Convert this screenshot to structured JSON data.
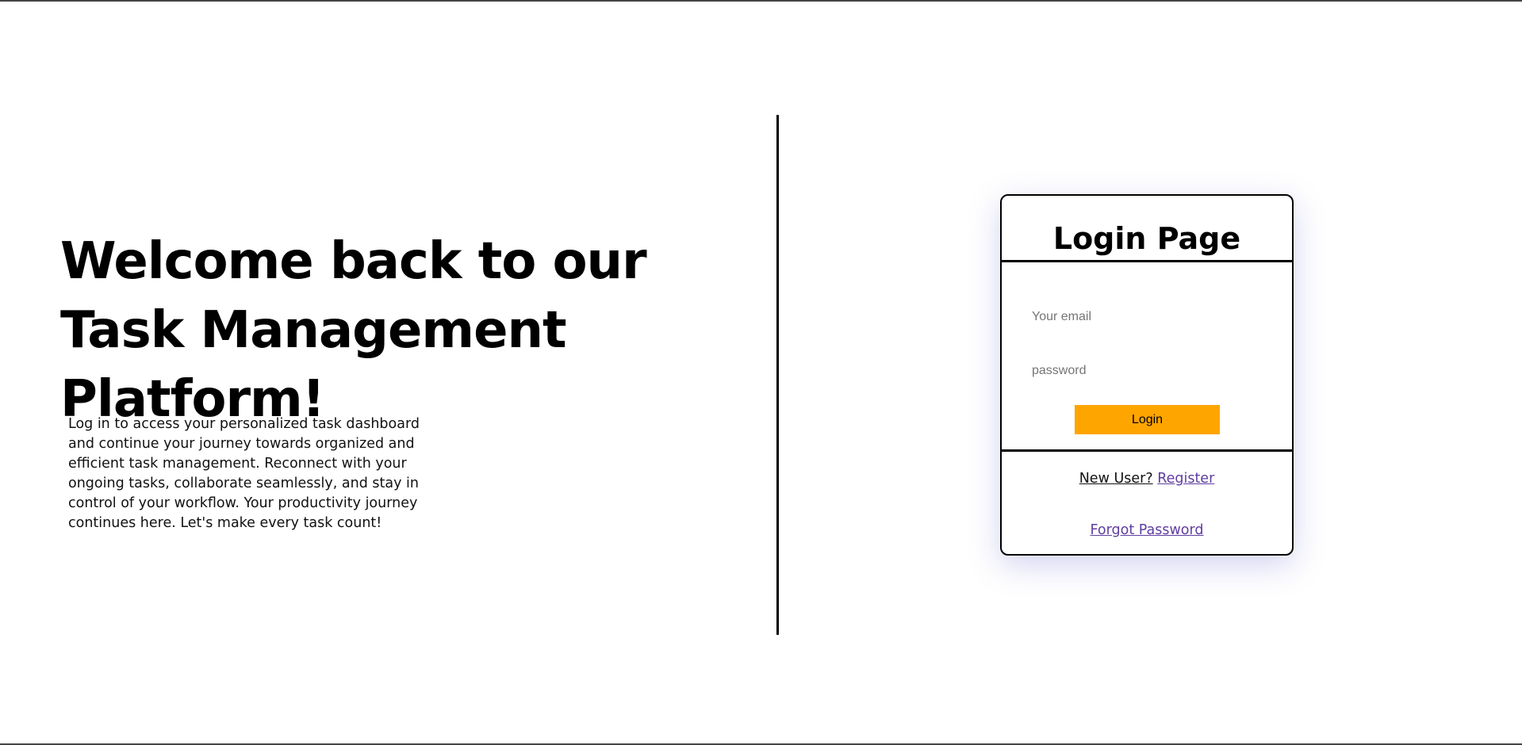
{
  "hero": {
    "heading": "Welcome back to our Task Management Platform!",
    "intro": "Log in to access your personalized task dashboard and continue your journey towards organized and efficient task management. Reconnect with your ongoing tasks, collaborate seamlessly, and stay in control of your workflow. Your productivity journey continues here. Let's make every task count!"
  },
  "login": {
    "title": "Login Page",
    "email_placeholder": "Your email",
    "password_placeholder": "password",
    "button_label": "Login",
    "new_user_text": "New User?",
    "register_link": "Register",
    "forgot_link": "Forgot Password"
  },
  "colors": {
    "button": "#ffa500",
    "link": "#5f3da0",
    "card_border": "#000000"
  }
}
